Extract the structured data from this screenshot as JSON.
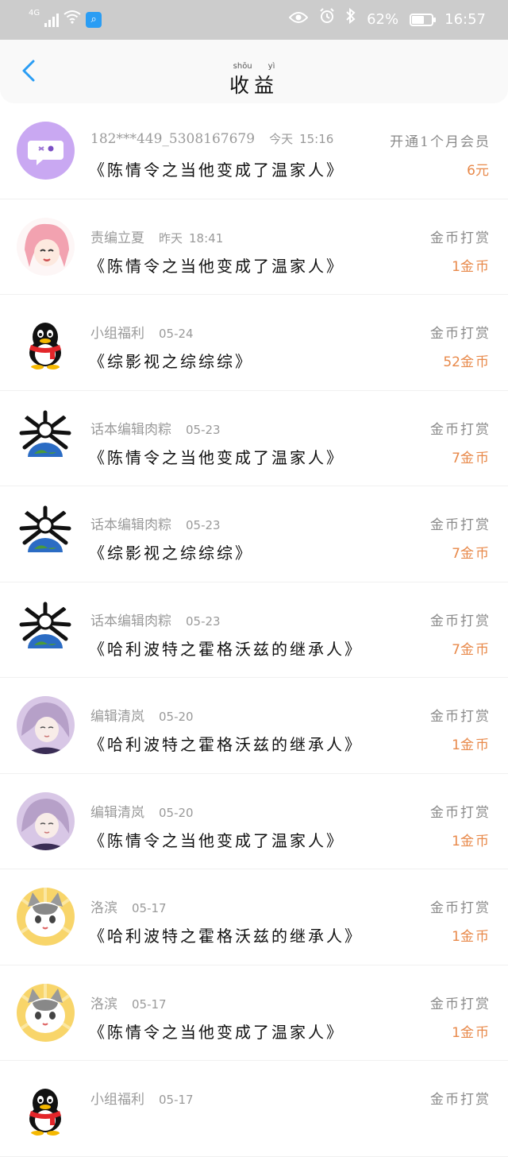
{
  "status_bar": {
    "network": "4G",
    "battery_text": "62%",
    "battery_level": 0.62,
    "time": "16:57"
  },
  "header": {
    "title": "收益",
    "title_pinyin": [
      "shōu",
      "yì"
    ]
  },
  "colors": {
    "accent_back": "#2a9df4",
    "amount": "#e8894a"
  },
  "rows": [
    {
      "user": "182***449_5308167679",
      "time_label": "今天",
      "time": "15:16",
      "book": "《陈情令之当他变成了温家人》",
      "action": "开通1个月会员",
      "amount": "6",
      "unit": "元",
      "avatar": "chat-bubble-icon"
    },
    {
      "user": "责编立夏",
      "time_label": "昨天",
      "time": "18:41",
      "book": "《陈情令之当他变成了温家人》",
      "action": "金币打赏",
      "amount": "1",
      "unit": "金币",
      "avatar": "anime-girl-pink-hair"
    },
    {
      "user": "小组福利",
      "time_label": "",
      "time": "05-24",
      "book": "《综影视之综综综》",
      "action": "金币打赏",
      "amount": "52",
      "unit": "金币",
      "avatar": "qq-penguin-icon"
    },
    {
      "user": "话本编辑肉粽",
      "time_label": "",
      "time": "05-23",
      "book": "《陈情令之当他变成了温家人》",
      "action": "金币打赏",
      "amount": "7",
      "unit": "金币",
      "avatar": "earth-bones-icon"
    },
    {
      "user": "话本编辑肉粽",
      "time_label": "",
      "time": "05-23",
      "book": "《综影视之综综综》",
      "action": "金币打赏",
      "amount": "7",
      "unit": "金币",
      "avatar": "earth-bones-icon"
    },
    {
      "user": "话本编辑肉粽",
      "time_label": "",
      "time": "05-23",
      "book": "《哈利波特之霍格沃兹的继承人》",
      "action": "金币打赏",
      "amount": "7",
      "unit": "金币",
      "avatar": "earth-bones-icon"
    },
    {
      "user": "编辑清岚",
      "time_label": "",
      "time": "05-20",
      "book": "《哈利波特之霍格沃兹的继承人》",
      "action": "金币打赏",
      "amount": "1",
      "unit": "金币",
      "avatar": "anime-girl-purple"
    },
    {
      "user": "编辑清岚",
      "time_label": "",
      "time": "05-20",
      "book": "《陈情令之当他变成了温家人》",
      "action": "金币打赏",
      "amount": "1",
      "unit": "金币",
      "avatar": "anime-girl-purple"
    },
    {
      "user": "洛滨",
      "time_label": "",
      "time": "05-17",
      "book": "《哈利波特之霍格沃兹的继承人》",
      "action": "金币打赏",
      "amount": "1",
      "unit": "金币",
      "avatar": "cat-avatar"
    },
    {
      "user": "洛滨",
      "time_label": "",
      "time": "05-17",
      "book": "《陈情令之当他变成了温家人》",
      "action": "金币打赏",
      "amount": "1",
      "unit": "金币",
      "avatar": "cat-avatar"
    },
    {
      "user": "小组福利",
      "time_label": "",
      "time": "05-17",
      "book": "",
      "action": "金币打赏",
      "amount": "",
      "unit": "",
      "avatar": "qq-penguin-icon"
    }
  ]
}
